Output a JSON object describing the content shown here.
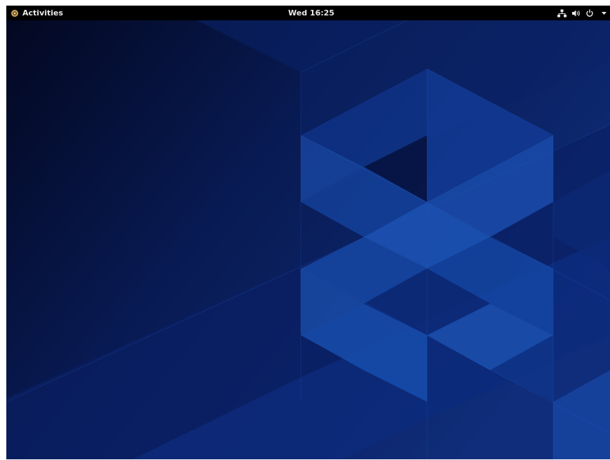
{
  "topbar": {
    "activities_label": "Activities",
    "clock": "Wed 16:25"
  },
  "icons": {
    "activities": "activities-icon",
    "network": "network-wired-icon",
    "volume": "volume-icon",
    "power": "power-icon",
    "menu": "chevron-down-icon"
  },
  "colors": {
    "topbar": "#000000",
    "topbar_text": "#e8e8e8",
    "wallpaper_dark": "#050a26",
    "wallpaper_mid": "#0d2470",
    "wallpaper_light": "#1c4ea8"
  }
}
